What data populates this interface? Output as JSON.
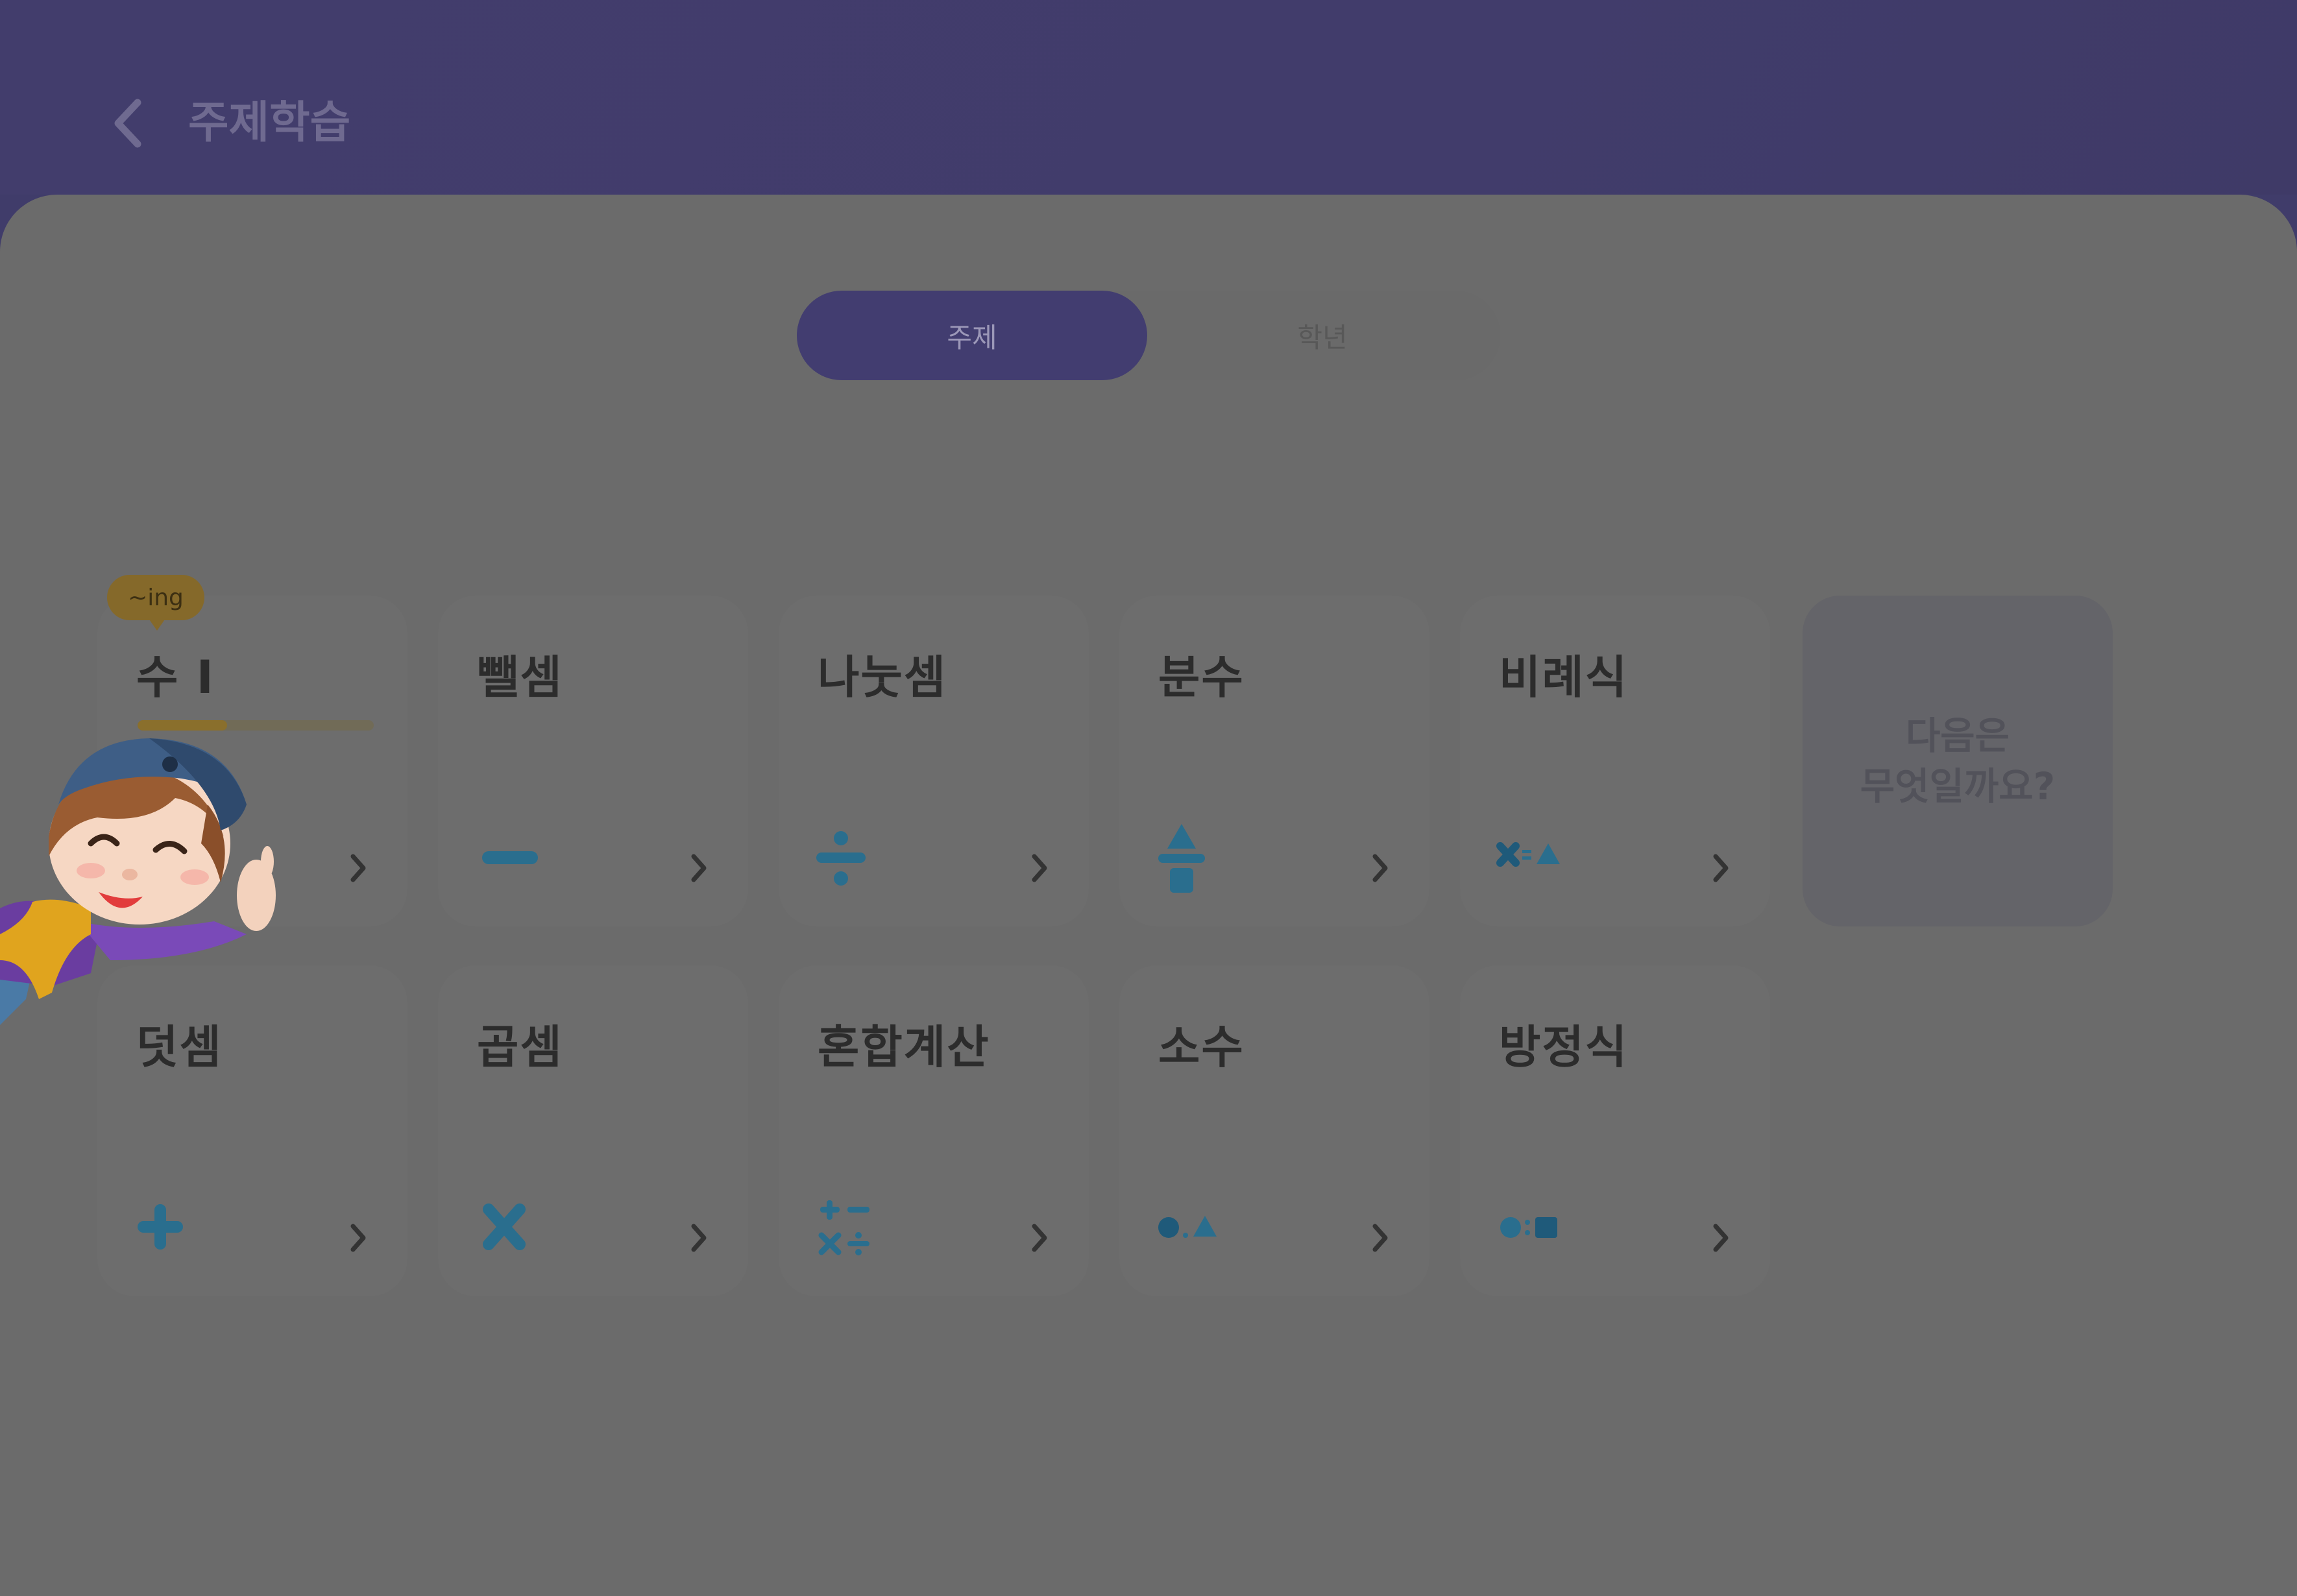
{
  "header": {
    "title": "주제학습",
    "back_icon": "chevron-left-icon"
  },
  "tabs": {
    "active": "주제",
    "inactive": "학년"
  },
  "badge": {
    "label": "~ing"
  },
  "cards": [
    {
      "title": "수 I",
      "icon": "number-icon",
      "progress": 0.38
    },
    {
      "title": "뺄셈",
      "icon": "minus-icon"
    },
    {
      "title": "나눗셈",
      "icon": "divide-icon"
    },
    {
      "title": "분수",
      "icon": "fraction-icon"
    },
    {
      "title": "비례식",
      "icon": "ratio-equation-icon"
    },
    {
      "title": "덧셈",
      "icon": "plus-icon"
    },
    {
      "title": "곱셈",
      "icon": "multiply-icon"
    },
    {
      "title": "혼합계산",
      "icon": "mixed-operations-icon"
    },
    {
      "title": "소수",
      "icon": "decimal-icon"
    },
    {
      "title": "방정식",
      "icon": "equation-icon"
    }
  ],
  "next_card": {
    "text": "다음은\n무엇일까요?"
  },
  "colors": {
    "header_bg": "#413c6b",
    "panel_bg": "#6b6b6b",
    "active_tab": "#423d70",
    "icon_blue": "#2a6e8e",
    "progress": "#8a6f2c"
  }
}
